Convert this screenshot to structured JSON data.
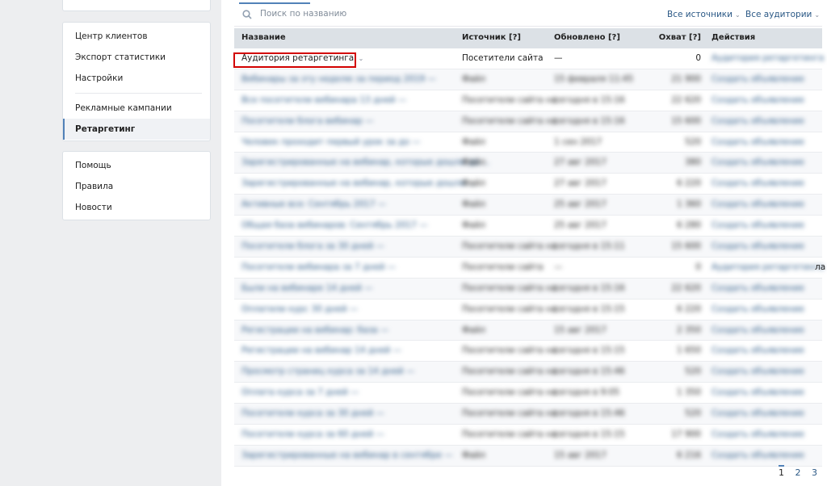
{
  "sidebar": {
    "items": [
      {
        "label": "Центр клиентов",
        "active": false
      },
      {
        "label": "Экспорт статистики",
        "active": false
      },
      {
        "label": "Настройки",
        "active": false
      },
      {
        "label": "Рекламные кампании",
        "active": false
      },
      {
        "label": "Ретаргетинг",
        "active": true
      }
    ],
    "help_items": [
      {
        "label": "Помощь"
      },
      {
        "label": "Правила"
      },
      {
        "label": "Новости"
      }
    ]
  },
  "search": {
    "placeholder": "Поиск по названию",
    "filter_sources": "Все источники",
    "filter_audiences": "Все аудитории"
  },
  "table": {
    "headers": {
      "name": "Название",
      "source": "Источник [?]",
      "updated": "Обновлено [?]",
      "reach": "Охват [?]",
      "actions": "Действия"
    },
    "first_row": {
      "name": "Аудитория ретаргетинга",
      "source": "Посетители сайта",
      "updated": "—",
      "reach": "0"
    },
    "blurred_rows": [
      {
        "name": "Вебинары за эту неделю за период 2019 —",
        "source": "Файл",
        "updated": "15 февраля 11:45",
        "reach": "21 900",
        "action": "Создать объявление"
      },
      {
        "name": "Все посетители вебинара 13 дней —",
        "source": "Посетители сайта на",
        "updated": "сегодня в 15:16",
        "reach": "22 620",
        "action": "Создать объявление"
      },
      {
        "name": "Посетители блога вебинар —",
        "source": "Посетители сайта на",
        "updated": "сегодня в 15:16",
        "reach": "15 600",
        "action": "Создать объявление"
      },
      {
        "name": "Человек проходит первый урок за до —",
        "source": "Файл",
        "updated": "1 сен 2017",
        "reach": "520",
        "action": "Создать объявление"
      },
      {
        "name": "Зарегистрированные на вебинар, которые дошли до ...",
        "source": "Файл",
        "updated": "27 авг 2017",
        "reach": "380",
        "action": "Создать объявление"
      },
      {
        "name": "Зарегистрированные на вебинар, которые дошли ...",
        "source": "Файл",
        "updated": "27 авг 2017",
        "reach": "6 220",
        "action": "Создать объявление"
      },
      {
        "name": "Активные все: Сентябрь 2017 —",
        "source": "Файл",
        "updated": "25 авг 2017",
        "reach": "1 360",
        "action": "Создать объявление"
      },
      {
        "name": "Общая база вебинаров: Сентябрь 2017 —",
        "source": "Файл",
        "updated": "25 авг 2017",
        "reach": "6 280",
        "action": "Создать объявление"
      },
      {
        "name": "Посетители блога за 30 дней —",
        "source": "Посетители сайта на",
        "updated": "сегодня в 15:11",
        "reach": "15 600",
        "action": "Создать объявление"
      },
      {
        "name": "Посетители вебинара за 7 дней —",
        "source": "Посетители сайта",
        "updated": "—",
        "reach": "0",
        "action": "Аудитория ретаргетинга"
      },
      {
        "name": "Были на вебинаре 14 дней —",
        "source": "Посетители сайта на",
        "updated": "сегодня в 15:16",
        "reach": "22 620",
        "action": "Создать объявление"
      },
      {
        "name": "Оплатили курс 30 дней —",
        "source": "Посетители сайта на",
        "updated": "сегодня в 15:15",
        "reach": "6 220",
        "action": "Создать объявление"
      },
      {
        "name": "Регистрации на вебинар: база —",
        "source": "Файл",
        "updated": "15 авг 2017",
        "reach": "2 350",
        "action": "Создать объявление"
      },
      {
        "name": "Регистрации на вебинар 14 дней —",
        "source": "Посетители сайта на",
        "updated": "сегодня в 15:15",
        "reach": "1 650",
        "action": "Создать объявление"
      },
      {
        "name": "Просмотр страниц курса за 14 дней —",
        "source": "Посетители сайта на",
        "updated": "сегодня в 15:46",
        "reach": "520",
        "action": "Создать объявление"
      },
      {
        "name": "Оплата курса за 7 дней —",
        "source": "Посетители сайта на",
        "updated": "сегодня в 9:05",
        "reach": "1 350",
        "action": "Создать объявление"
      },
      {
        "name": "Посетители курса за 30 дней —",
        "source": "Посетители сайта на",
        "updated": "сегодня в 15:46",
        "reach": "520",
        "action": "Создать объявление"
      },
      {
        "name": "Посетители курса за 60 дней —",
        "source": "Посетители сайта на",
        "updated": "сегодня в 15:15",
        "reach": "17 900",
        "action": "Создать объявление"
      },
      {
        "name": "Зарегистрированные на вебинар в сентябре —",
        "source": "Файл",
        "updated": "15 авг 2017",
        "reach": "6 216",
        "action": "Создать объявление"
      }
    ]
  },
  "stray_text": "ла",
  "pagination": {
    "pages": [
      "1",
      "2",
      "3"
    ],
    "current": "1"
  },
  "icons": {
    "search": "search-icon",
    "chevron": "chevron-down-icon"
  },
  "colors": {
    "accent": "#5181b8",
    "link": "#2a5885",
    "highlight": "#d20000",
    "header_bg": "#dce1e6"
  }
}
